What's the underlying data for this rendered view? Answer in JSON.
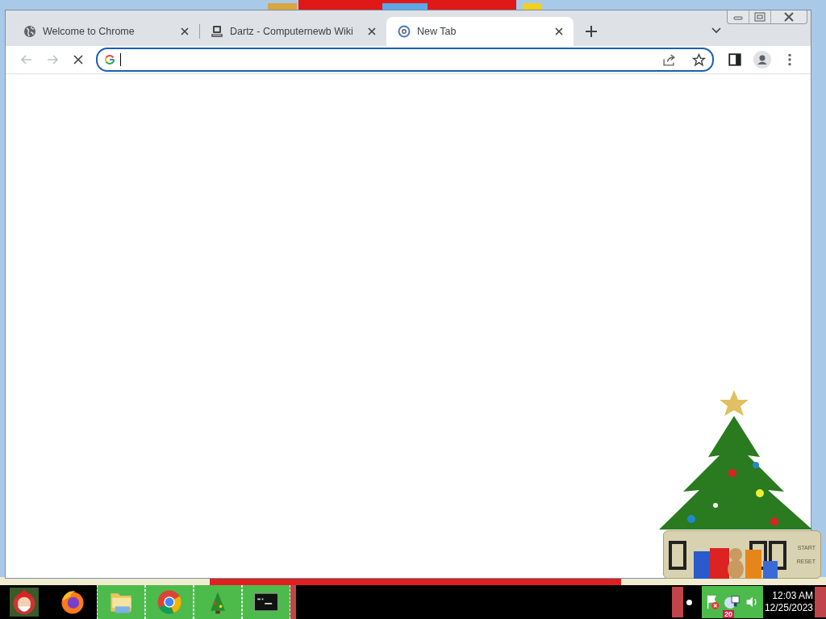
{
  "tabs": [
    {
      "title": "Welcome to Chrome",
      "kind": "globe",
      "selected": false
    },
    {
      "title": "Dartz - Computernewb Wiki",
      "kind": "computer",
      "selected": false
    },
    {
      "title": "New Tab",
      "kind": "loading",
      "selected": true
    }
  ],
  "toolbar": {
    "loading": true
  },
  "stopwatch": {
    "buttons": [
      "START",
      "RESET"
    ]
  },
  "taskbar": {
    "apps": [
      {
        "kind": "santa",
        "running": false
      },
      {
        "kind": "firefox",
        "running": false
      },
      {
        "kind": "folder",
        "running": true
      },
      {
        "kind": "chrome",
        "running": true
      },
      {
        "kind": "tree",
        "running": true
      },
      {
        "kind": "terminal",
        "running": true
      }
    ],
    "tray_badge": "20",
    "time": "12:03 AM",
    "date": "12/25/2023"
  }
}
